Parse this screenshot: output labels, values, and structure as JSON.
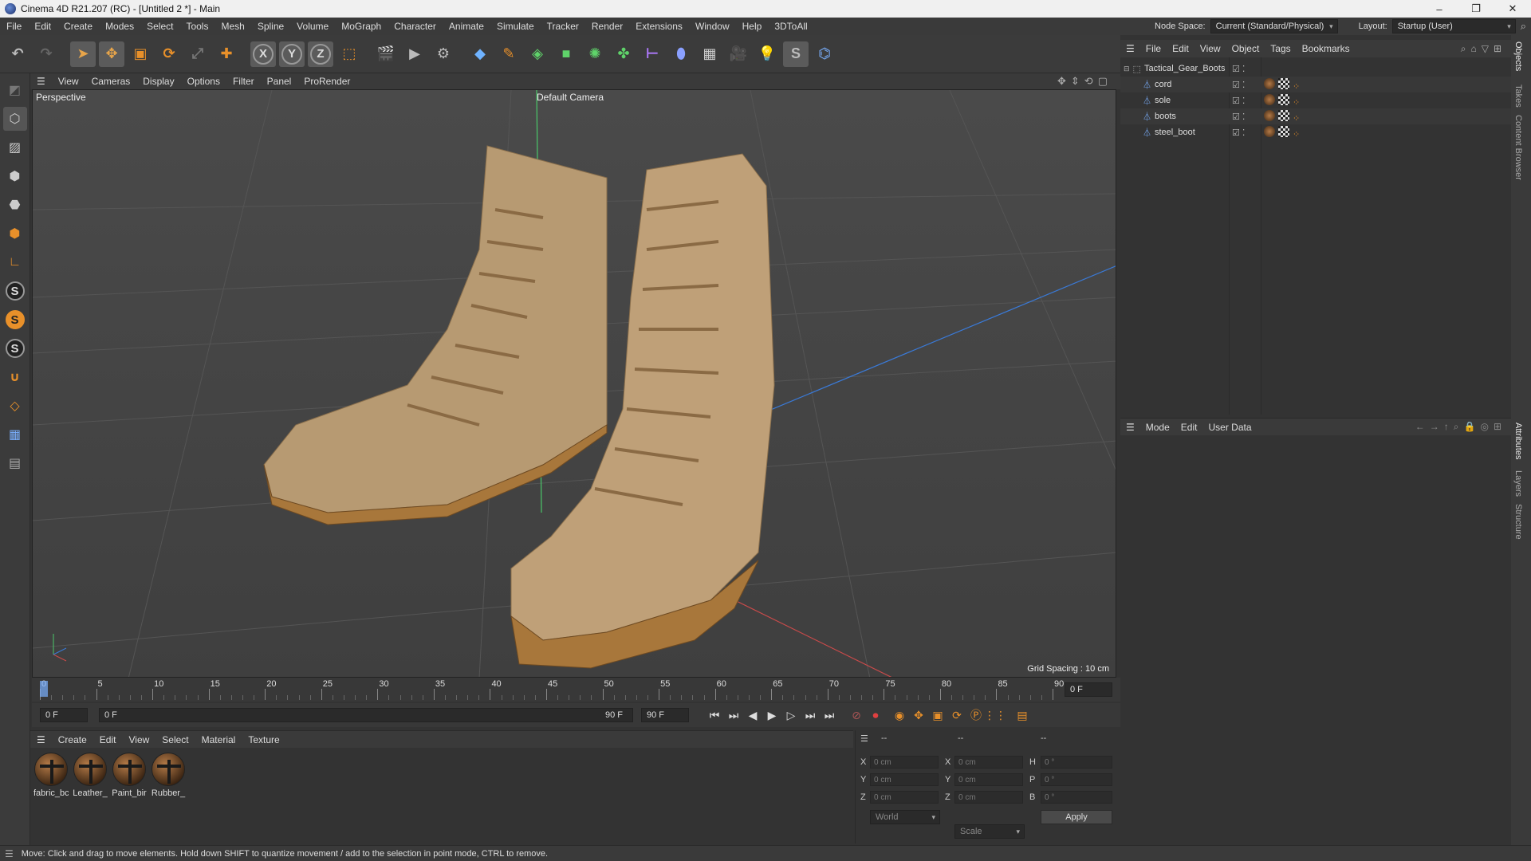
{
  "window": {
    "title": "Cinema 4D R21.207 (RC) - [Untitled 2 *] - Main",
    "min": "–",
    "max": "❐",
    "close": "✕"
  },
  "menu": [
    "File",
    "Edit",
    "Create",
    "Modes",
    "Select",
    "Tools",
    "Mesh",
    "Spline",
    "Volume",
    "MoGraph",
    "Character",
    "Animate",
    "Simulate",
    "Tracker",
    "Render",
    "Extensions",
    "Window",
    "Help",
    "3DToAll"
  ],
  "nodespace": {
    "label": "Node Space:",
    "value": "Current (Standard/Physical)"
  },
  "layout": {
    "label": "Layout:",
    "value": "Startup (User)"
  },
  "viewport_menu": [
    "View",
    "Cameras",
    "Display",
    "Options",
    "Filter",
    "Panel",
    "ProRender"
  ],
  "viewport": {
    "view_name": "Perspective",
    "camera": "Default Camera",
    "grid_spacing": "Grid Spacing : 10 cm"
  },
  "timeline": {
    "ticks": [
      "0",
      "5",
      "10",
      "15",
      "20",
      "25",
      "30",
      "35",
      "40",
      "45",
      "50",
      "55",
      "60",
      "65",
      "70",
      "75",
      "80",
      "85",
      "90"
    ],
    "frame_end_display": "0 F"
  },
  "playback": {
    "current": "0 F",
    "range_start": "0 F",
    "range_end": "90 F",
    "max": "90 F"
  },
  "material_menu": [
    "Create",
    "Edit",
    "View",
    "Select",
    "Material",
    "Texture"
  ],
  "materials": [
    "fabric_bc",
    "Leather_",
    "Paint_bir",
    "Rubber_"
  ],
  "coords": {
    "headers": [
      "--",
      "--",
      "--"
    ],
    "rows": [
      {
        "a": "X",
        "av": "0 cm",
        "b": "X",
        "bv": "0 cm",
        "c": "H",
        "cv": "0 °"
      },
      {
        "a": "Y",
        "av": "0 cm",
        "b": "Y",
        "bv": "0 cm",
        "c": "P",
        "cv": "0 °"
      },
      {
        "a": "Z",
        "av": "0 cm",
        "b": "Z",
        "bv": "0 cm",
        "c": "B",
        "cv": "0 °"
      }
    ],
    "world": "World",
    "scale": "Scale",
    "apply": "Apply"
  },
  "status": "Move: Click and drag to move elements. Hold down SHIFT to quantize movement / add to the selection in point mode, CTRL to remove.",
  "object_menu": [
    "File",
    "Edit",
    "View",
    "Object",
    "Tags",
    "Bookmarks"
  ],
  "objects": {
    "root": "Tactical_Gear_Boots",
    "children": [
      "cord",
      "sole",
      "boots",
      "steel_boot"
    ]
  },
  "attr_menu": [
    "Mode",
    "Edit",
    "User Data"
  ],
  "side_tabs": [
    "Objects",
    "Takes",
    "Content Browser",
    "Attributes",
    "Layers",
    "Structure"
  ],
  "colors": {
    "accent_orange": "#e8902a",
    "axis_x": "#c84a4a",
    "axis_y": "#4ac86a",
    "axis_z": "#3a7ad8"
  }
}
